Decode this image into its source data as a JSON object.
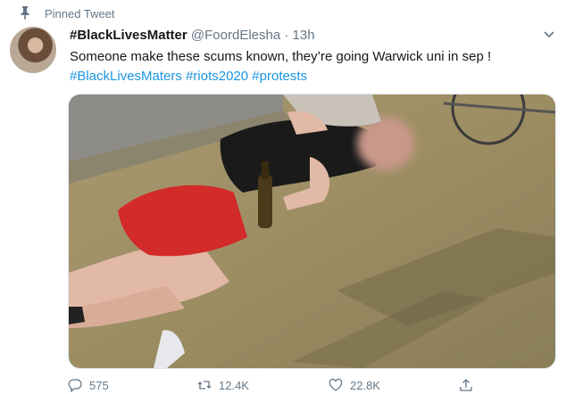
{
  "pinned": {
    "label": "Pinned Tweet",
    "icon": "pin-icon"
  },
  "tweet": {
    "display_name": "#BlackLivesMatter",
    "handle": "@FoordElesha",
    "separator": "·",
    "time": "13h",
    "text": "Someone make these scums known, they’re going Warwick uni in sep !",
    "hashtags": [
      "#BlackLivesMaters",
      "#riots2020",
      "#protests"
    ],
    "link_color": "#1b95e0"
  },
  "actions": {
    "reply": {
      "icon": "reply-icon",
      "count": "575"
    },
    "retweet": {
      "icon": "retweet-icon",
      "count": "12.4K"
    },
    "like": {
      "icon": "heart-icon",
      "count": "22.8K"
    },
    "share": {
      "icon": "share-icon"
    }
  }
}
